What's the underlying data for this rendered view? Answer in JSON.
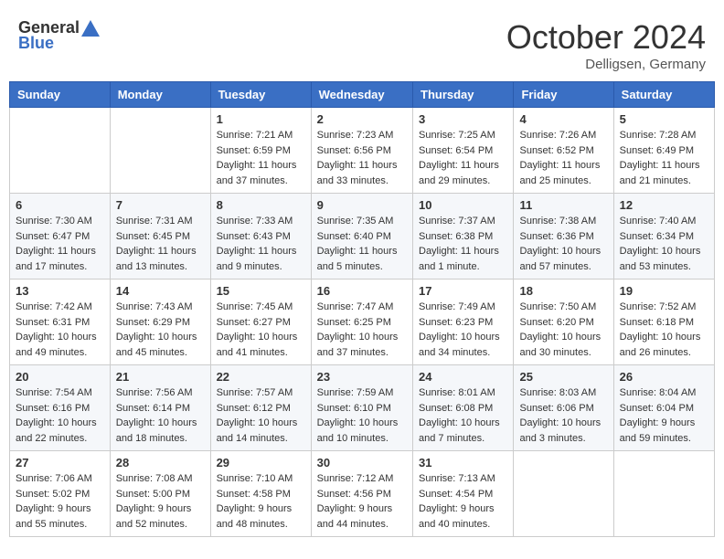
{
  "header": {
    "logo_general": "General",
    "logo_blue": "Blue",
    "month_title": "October 2024",
    "subtitle": "Delligsen, Germany"
  },
  "days_of_week": [
    "Sunday",
    "Monday",
    "Tuesday",
    "Wednesday",
    "Thursday",
    "Friday",
    "Saturday"
  ],
  "weeks": [
    [
      {
        "day": "",
        "sunrise": "",
        "sunset": "",
        "daylight": ""
      },
      {
        "day": "",
        "sunrise": "",
        "sunset": "",
        "daylight": ""
      },
      {
        "day": "1",
        "sunrise": "Sunrise: 7:21 AM",
        "sunset": "Sunset: 6:59 PM",
        "daylight": "Daylight: 11 hours and 37 minutes."
      },
      {
        "day": "2",
        "sunrise": "Sunrise: 7:23 AM",
        "sunset": "Sunset: 6:56 PM",
        "daylight": "Daylight: 11 hours and 33 minutes."
      },
      {
        "day": "3",
        "sunrise": "Sunrise: 7:25 AM",
        "sunset": "Sunset: 6:54 PM",
        "daylight": "Daylight: 11 hours and 29 minutes."
      },
      {
        "day": "4",
        "sunrise": "Sunrise: 7:26 AM",
        "sunset": "Sunset: 6:52 PM",
        "daylight": "Daylight: 11 hours and 25 minutes."
      },
      {
        "day": "5",
        "sunrise": "Sunrise: 7:28 AM",
        "sunset": "Sunset: 6:49 PM",
        "daylight": "Daylight: 11 hours and 21 minutes."
      }
    ],
    [
      {
        "day": "6",
        "sunrise": "Sunrise: 7:30 AM",
        "sunset": "Sunset: 6:47 PM",
        "daylight": "Daylight: 11 hours and 17 minutes."
      },
      {
        "day": "7",
        "sunrise": "Sunrise: 7:31 AM",
        "sunset": "Sunset: 6:45 PM",
        "daylight": "Daylight: 11 hours and 13 minutes."
      },
      {
        "day": "8",
        "sunrise": "Sunrise: 7:33 AM",
        "sunset": "Sunset: 6:43 PM",
        "daylight": "Daylight: 11 hours and 9 minutes."
      },
      {
        "day": "9",
        "sunrise": "Sunrise: 7:35 AM",
        "sunset": "Sunset: 6:40 PM",
        "daylight": "Daylight: 11 hours and 5 minutes."
      },
      {
        "day": "10",
        "sunrise": "Sunrise: 7:37 AM",
        "sunset": "Sunset: 6:38 PM",
        "daylight": "Daylight: 11 hours and 1 minute."
      },
      {
        "day": "11",
        "sunrise": "Sunrise: 7:38 AM",
        "sunset": "Sunset: 6:36 PM",
        "daylight": "Daylight: 10 hours and 57 minutes."
      },
      {
        "day": "12",
        "sunrise": "Sunrise: 7:40 AM",
        "sunset": "Sunset: 6:34 PM",
        "daylight": "Daylight: 10 hours and 53 minutes."
      }
    ],
    [
      {
        "day": "13",
        "sunrise": "Sunrise: 7:42 AM",
        "sunset": "Sunset: 6:31 PM",
        "daylight": "Daylight: 10 hours and 49 minutes."
      },
      {
        "day": "14",
        "sunrise": "Sunrise: 7:43 AM",
        "sunset": "Sunset: 6:29 PM",
        "daylight": "Daylight: 10 hours and 45 minutes."
      },
      {
        "day": "15",
        "sunrise": "Sunrise: 7:45 AM",
        "sunset": "Sunset: 6:27 PM",
        "daylight": "Daylight: 10 hours and 41 minutes."
      },
      {
        "day": "16",
        "sunrise": "Sunrise: 7:47 AM",
        "sunset": "Sunset: 6:25 PM",
        "daylight": "Daylight: 10 hours and 37 minutes."
      },
      {
        "day": "17",
        "sunrise": "Sunrise: 7:49 AM",
        "sunset": "Sunset: 6:23 PM",
        "daylight": "Daylight: 10 hours and 34 minutes."
      },
      {
        "day": "18",
        "sunrise": "Sunrise: 7:50 AM",
        "sunset": "Sunset: 6:20 PM",
        "daylight": "Daylight: 10 hours and 30 minutes."
      },
      {
        "day": "19",
        "sunrise": "Sunrise: 7:52 AM",
        "sunset": "Sunset: 6:18 PM",
        "daylight": "Daylight: 10 hours and 26 minutes."
      }
    ],
    [
      {
        "day": "20",
        "sunrise": "Sunrise: 7:54 AM",
        "sunset": "Sunset: 6:16 PM",
        "daylight": "Daylight: 10 hours and 22 minutes."
      },
      {
        "day": "21",
        "sunrise": "Sunrise: 7:56 AM",
        "sunset": "Sunset: 6:14 PM",
        "daylight": "Daylight: 10 hours and 18 minutes."
      },
      {
        "day": "22",
        "sunrise": "Sunrise: 7:57 AM",
        "sunset": "Sunset: 6:12 PM",
        "daylight": "Daylight: 10 hours and 14 minutes."
      },
      {
        "day": "23",
        "sunrise": "Sunrise: 7:59 AM",
        "sunset": "Sunset: 6:10 PM",
        "daylight": "Daylight: 10 hours and 10 minutes."
      },
      {
        "day": "24",
        "sunrise": "Sunrise: 8:01 AM",
        "sunset": "Sunset: 6:08 PM",
        "daylight": "Daylight: 10 hours and 7 minutes."
      },
      {
        "day": "25",
        "sunrise": "Sunrise: 8:03 AM",
        "sunset": "Sunset: 6:06 PM",
        "daylight": "Daylight: 10 hours and 3 minutes."
      },
      {
        "day": "26",
        "sunrise": "Sunrise: 8:04 AM",
        "sunset": "Sunset: 6:04 PM",
        "daylight": "Daylight: 9 hours and 59 minutes."
      }
    ],
    [
      {
        "day": "27",
        "sunrise": "Sunrise: 7:06 AM",
        "sunset": "Sunset: 5:02 PM",
        "daylight": "Daylight: 9 hours and 55 minutes."
      },
      {
        "day": "28",
        "sunrise": "Sunrise: 7:08 AM",
        "sunset": "Sunset: 5:00 PM",
        "daylight": "Daylight: 9 hours and 52 minutes."
      },
      {
        "day": "29",
        "sunrise": "Sunrise: 7:10 AM",
        "sunset": "Sunset: 4:58 PM",
        "daylight": "Daylight: 9 hours and 48 minutes."
      },
      {
        "day": "30",
        "sunrise": "Sunrise: 7:12 AM",
        "sunset": "Sunset: 4:56 PM",
        "daylight": "Daylight: 9 hours and 44 minutes."
      },
      {
        "day": "31",
        "sunrise": "Sunrise: 7:13 AM",
        "sunset": "Sunset: 4:54 PM",
        "daylight": "Daylight: 9 hours and 40 minutes."
      },
      {
        "day": "",
        "sunrise": "",
        "sunset": "",
        "daylight": ""
      },
      {
        "day": "",
        "sunrise": "",
        "sunset": "",
        "daylight": ""
      }
    ]
  ]
}
